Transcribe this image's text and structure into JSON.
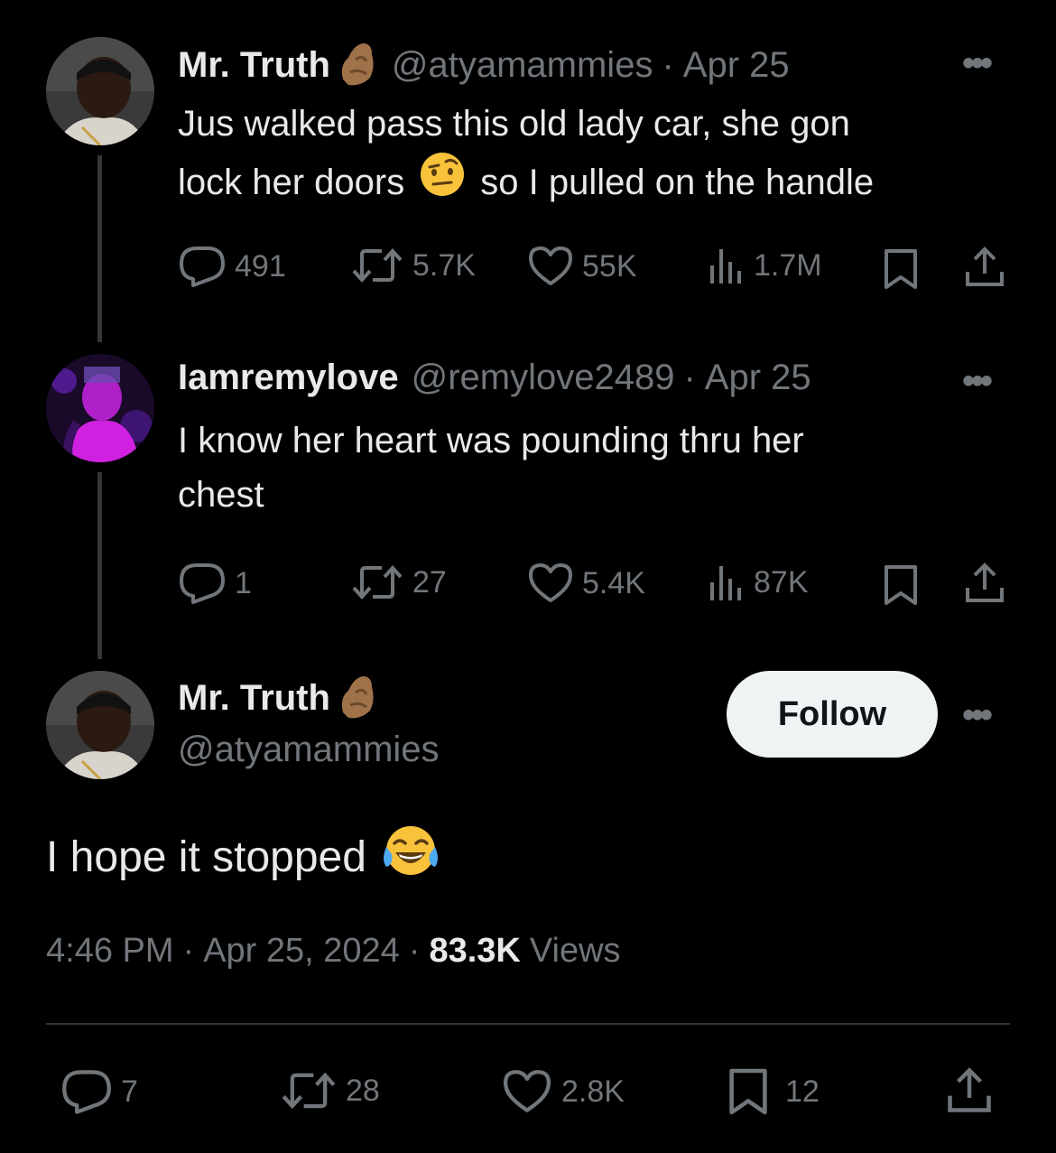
{
  "tweets": [
    {
      "name": "Mr. Truth",
      "handle": "@atyamammies",
      "date": "Apr 25",
      "text_line1_a": "Jus walked pass this old lady car, she gon",
      "text_line2_a": "lock her doors",
      "text_line2_b": "so I pulled on the handle",
      "replies": "491",
      "reposts": "5.7K",
      "likes": "55K",
      "views": "1.7M"
    },
    {
      "name": "Iamremylove",
      "handle": "@remylove2489",
      "date": "Apr 25",
      "text_line1": "I know her heart was pounding thru her",
      "text_line2": "chest",
      "replies": "1",
      "reposts": "27",
      "likes": "5.4K",
      "views": "87K"
    }
  ],
  "main": {
    "name": "Mr. Truth",
    "handle": "@atyamammies",
    "follow_label": "Follow",
    "text": "I hope it stopped",
    "time": "4:46 PM",
    "date": "Apr 25, 2024",
    "views_count": "83.3K",
    "views_label": "Views",
    "replies": "7",
    "reposts": "28",
    "likes": "2.8K",
    "bookmarks": "12"
  },
  "separator_dot": "·",
  "more_glyph": "•••",
  "icons": {
    "reply": "reply-icon",
    "repost": "repost-icon",
    "like": "heart-icon",
    "views": "views-icon",
    "bookmark": "bookmark-icon",
    "share": "share-icon",
    "name_emoji": "pinched-hand-emoji",
    "raised_eyebrow": "raised-eyebrow-emoji",
    "tears_of_joy": "tears-of-joy-emoji"
  },
  "colors": {
    "background": "#000000",
    "text_primary": "#e7e9ea",
    "text_secondary": "#71767b",
    "thread_line": "#333639",
    "follow_bg": "#eff3f4"
  }
}
